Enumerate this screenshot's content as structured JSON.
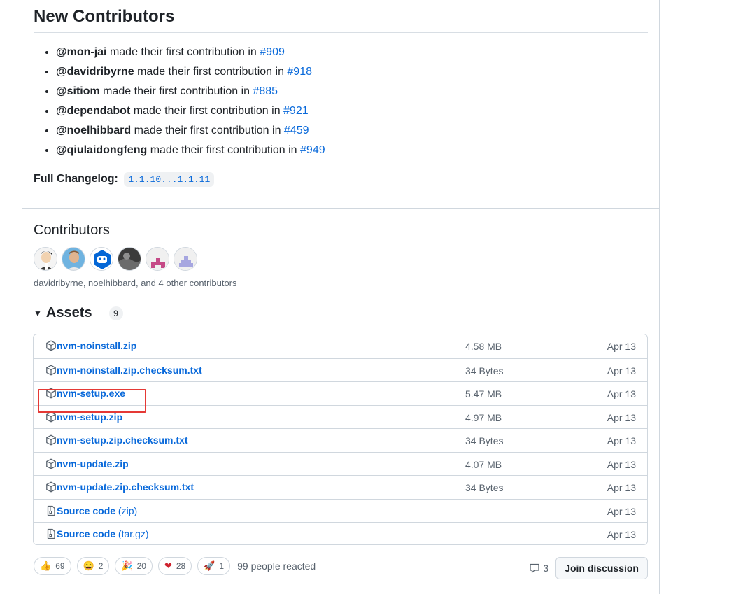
{
  "new_contributors": {
    "title": "New Contributors",
    "items": [
      {
        "user": "@mon-jai",
        "text": " made their first contribution in ",
        "pr": "#909"
      },
      {
        "user": "@davidribyrne",
        "text": " made their first contribution in ",
        "pr": "#918"
      },
      {
        "user": "@sitiom",
        "text": " made their first contribution in ",
        "pr": "#885"
      },
      {
        "user": "@dependabot",
        "text": " made their first contribution in ",
        "pr": "#921"
      },
      {
        "user": "@noelhibbard",
        "text": " made their first contribution in ",
        "pr": "#459"
      },
      {
        "user": "@qiulaidongfeng",
        "text": " made their first contribution in ",
        "pr": "#949"
      }
    ],
    "changelog_label": "Full Changelog:",
    "changelog_link": "1.1.10...1.1.11"
  },
  "contributors": {
    "title": "Contributors",
    "summary": "davidribyrne, noelhibbard, and 4 other contributors",
    "avatar_icons": [
      "avatar-cartoon-man",
      "avatar-man-photo",
      "avatar-bot",
      "avatar-dark-photo",
      "avatar-pink-identicon",
      "avatar-lavender-identicon"
    ]
  },
  "assets": {
    "title": "Assets",
    "count": "9",
    "rows": [
      {
        "name": "nvm-noinstall.zip",
        "ext": "",
        "size": "4.58 MB",
        "date": "Apr 13",
        "icon": "package-icon"
      },
      {
        "name": "nvm-noinstall.zip.checksum.txt",
        "ext": "",
        "size": "34 Bytes",
        "date": "Apr 13",
        "icon": "package-icon"
      },
      {
        "name": "nvm-setup.exe",
        "ext": "",
        "size": "5.47 MB",
        "date": "Apr 13",
        "icon": "package-icon"
      },
      {
        "name": "nvm-setup.zip",
        "ext": "",
        "size": "4.97 MB",
        "date": "Apr 13",
        "icon": "package-icon"
      },
      {
        "name": "nvm-setup.zip.checksum.txt",
        "ext": "",
        "size": "34 Bytes",
        "date": "Apr 13",
        "icon": "package-icon"
      },
      {
        "name": "nvm-update.zip",
        "ext": "",
        "size": "4.07 MB",
        "date": "Apr 13",
        "icon": "package-icon"
      },
      {
        "name": "nvm-update.zip.checksum.txt",
        "ext": "",
        "size": "34 Bytes",
        "date": "Apr 13",
        "icon": "package-icon"
      },
      {
        "name": "Source code",
        "ext": " (zip)",
        "size": "",
        "date": "Apr 13",
        "icon": "file-zip-icon"
      },
      {
        "name": "Source code",
        "ext": " (tar.gz)",
        "size": "",
        "date": "Apr 13",
        "icon": "file-zip-icon"
      }
    ]
  },
  "reactions": {
    "items": [
      {
        "emoji": "👍",
        "count": "69",
        "name": "thumbs-up"
      },
      {
        "emoji": "😄",
        "count": "2",
        "name": "laugh"
      },
      {
        "emoji": "🎉",
        "count": "20",
        "name": "hooray"
      },
      {
        "emoji": "❤",
        "count": "28",
        "name": "heart"
      },
      {
        "emoji": "🚀",
        "count": "1",
        "name": "rocket"
      }
    ],
    "summary": "99 people reacted"
  },
  "discussion": {
    "comment_count": "3",
    "join_label": "Join discussion"
  },
  "colors": {
    "link": "#0969da",
    "highlight": "#e53935",
    "border": "#d0d7de"
  }
}
